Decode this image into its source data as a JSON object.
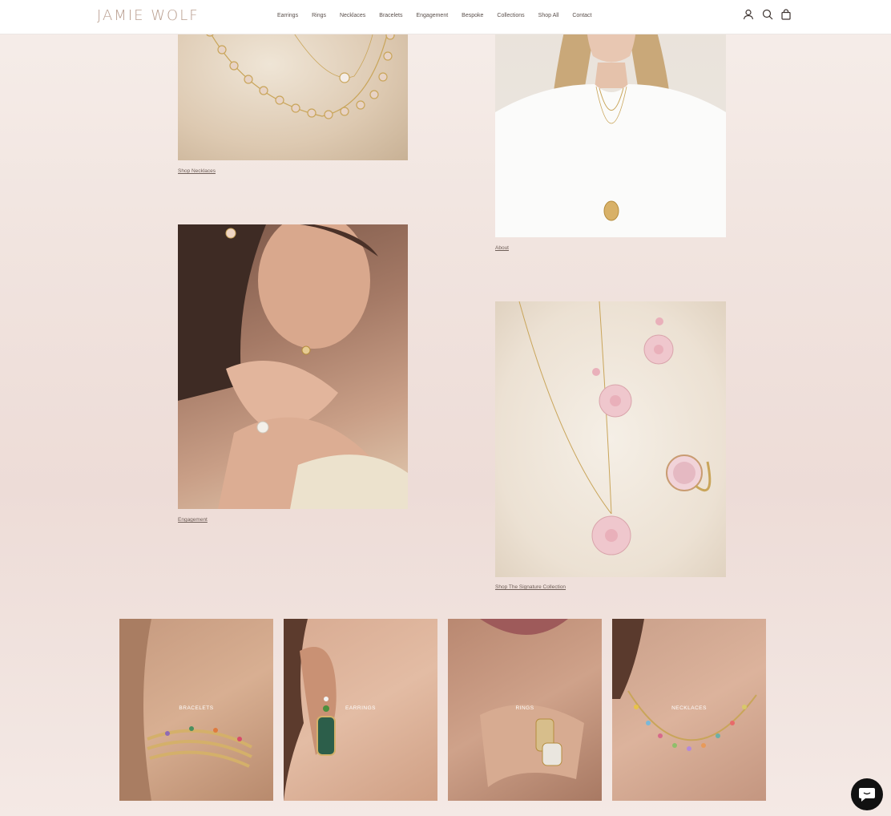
{
  "header": {
    "logo": "JAMIE WOLF",
    "nav": [
      "Earrings",
      "Rings",
      "Necklaces",
      "Bracelets",
      "Engagement",
      "Bespoke",
      "Collections",
      "Shop All",
      "Contact"
    ],
    "icons": [
      "account-icon",
      "search-icon",
      "cart-icon"
    ]
  },
  "features": {
    "necklaces_link": "Shop Necklaces",
    "about_link": "About",
    "engagement_link": "Engagement",
    "signature_link": "Shop The Signature Collection"
  },
  "categories": [
    {
      "label": "BRACELETS"
    },
    {
      "label": "EARRINGS"
    },
    {
      "label": "RINGS"
    },
    {
      "label": "NECKLACES"
    }
  ],
  "colors": {
    "accent": "#b89d8e",
    "background": "#f1e4df",
    "chat_button": "#111111"
  }
}
